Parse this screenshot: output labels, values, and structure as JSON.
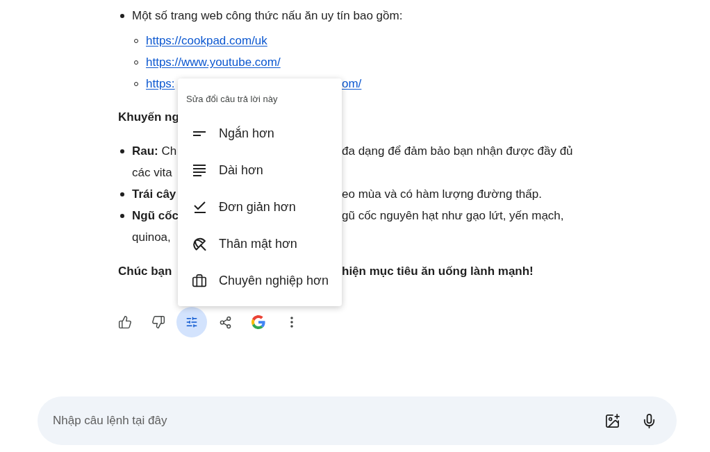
{
  "response": {
    "blocks": [
      {
        "kind": "bullet",
        "lines": [
          {
            "left": "Một số trang web công thức nấu ăn uy tín bao gồm:"
          }
        ],
        "children": [
          {
            "kind": "link",
            "left": "https://cookpad.com/uk"
          },
          {
            "kind": "link",
            "left": "https://www.youtube.com/"
          },
          {
            "kind": "link",
            "left": "https:",
            "right": "om/"
          }
        ]
      },
      {
        "kind": "heading",
        "lines": [
          {
            "left": "Khuyến ng"
          }
        ]
      },
      {
        "kind": "bullet",
        "lines": [
          {
            "left": "**Rau:** Ch",
            "right": "đa dạng để đảm bảo bạn nhận được đầy đủ"
          },
          {
            "left": "các vita"
          }
        ]
      },
      {
        "kind": "bullet",
        "lines": [
          {
            "left": "**Trái cây**",
            "right": "eo mùa và có hàm lượng đường thấp."
          }
        ]
      },
      {
        "kind": "bullet",
        "lines": [
          {
            "left": "**Ngũ cốc**",
            "right": "gũ cốc nguyên hạt như gạo lứt, yến mạch,"
          },
          {
            "left": "quinoa,"
          }
        ]
      },
      {
        "kind": "closing",
        "lines": [
          {
            "left": "Chúc bạn",
            "right": "hiện mục tiêu ăn uống lành mạnh!"
          }
        ]
      }
    ]
  },
  "actions": [
    {
      "kind": "like"
    },
    {
      "kind": "dislike"
    },
    {
      "kind": "modify"
    },
    {
      "kind": "share"
    },
    {
      "kind": "google"
    },
    {
      "kind": "more"
    }
  ],
  "modify_menu": {
    "open": true,
    "title": "Sửa đổi câu trả lời này",
    "items": [
      {
        "kind": "shorter",
        "label": "Ngắn hơn"
      },
      {
        "kind": "longer",
        "label": "Dài hơn"
      },
      {
        "kind": "simpler",
        "label": "Đơn giản hơn"
      },
      {
        "kind": "casual",
        "label": "Thân mật hơn"
      },
      {
        "kind": "professional",
        "label": "Chuyên nghiệp hơn"
      }
    ]
  },
  "prompt": {
    "placeholder": "Nhập câu lệnh tại đây"
  }
}
